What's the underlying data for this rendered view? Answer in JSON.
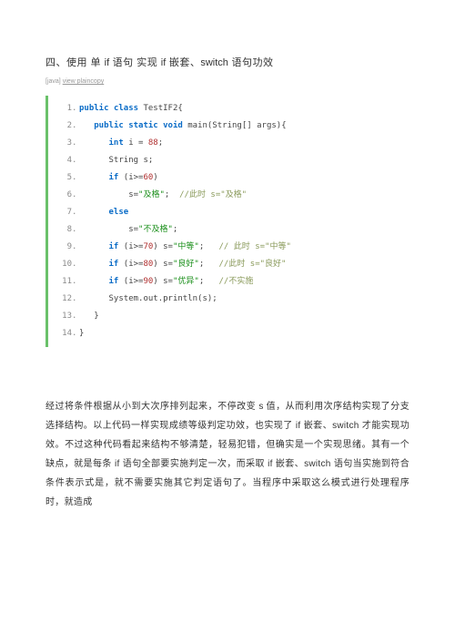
{
  "heading": {
    "prefix": "四、使用 单 ",
    "if": "if",
    "mid1": " 语句  实现 ",
    "if2": "if",
    "mid2": " 嵌套、",
    "switch": "switch",
    "suffix": " 语句功效"
  },
  "meta": {
    "lang": "[java]",
    "links": "view plaincopy"
  },
  "code": [
    {
      "n": "1",
      "parts": [
        {
          "t": "kw",
          "v": "public"
        },
        {
          "t": "p",
          "v": " "
        },
        {
          "t": "kw",
          "v": "class"
        },
        {
          "t": "p",
          "v": " TestIF2{"
        }
      ]
    },
    {
      "n": "2",
      "indent": "   ",
      "parts": [
        {
          "t": "kw",
          "v": "public"
        },
        {
          "t": "p",
          "v": " "
        },
        {
          "t": "kw",
          "v": "static"
        },
        {
          "t": "p",
          "v": " "
        },
        {
          "t": "type",
          "v": "void"
        },
        {
          "t": "p",
          "v": " main(String[] args){"
        }
      ]
    },
    {
      "n": "3",
      "indent": "      ",
      "parts": [
        {
          "t": "type",
          "v": "int"
        },
        {
          "t": "p",
          "v": " i = "
        },
        {
          "t": "num",
          "v": "88"
        },
        {
          "t": "p",
          "v": ";"
        }
      ]
    },
    {
      "n": "4",
      "indent": "      ",
      "parts": [
        {
          "t": "p",
          "v": "String s;"
        }
      ]
    },
    {
      "n": "5",
      "indent": "      ",
      "parts": [
        {
          "t": "kw",
          "v": "if"
        },
        {
          "t": "p",
          "v": " (i>="
        },
        {
          "t": "num",
          "v": "60"
        },
        {
          "t": "p",
          "v": ")"
        }
      ]
    },
    {
      "n": "6",
      "indent": "          ",
      "parts": [
        {
          "t": "p",
          "v": "s="
        },
        {
          "t": "str",
          "v": "\"及格\""
        },
        {
          "t": "p",
          "v": ";  "
        },
        {
          "t": "cmt",
          "v": "//此时 s=\"及格\""
        }
      ]
    },
    {
      "n": "7",
      "indent": "      ",
      "parts": [
        {
          "t": "kw",
          "v": "else"
        }
      ]
    },
    {
      "n": "8",
      "indent": "          ",
      "parts": [
        {
          "t": "p",
          "v": "s="
        },
        {
          "t": "str",
          "v": "\"不及格\""
        },
        {
          "t": "p",
          "v": ";"
        }
      ]
    },
    {
      "n": "9",
      "indent": "      ",
      "parts": [
        {
          "t": "kw",
          "v": "if"
        },
        {
          "t": "p",
          "v": " (i>="
        },
        {
          "t": "num",
          "v": "70"
        },
        {
          "t": "p",
          "v": ") s="
        },
        {
          "t": "str",
          "v": "\"中等\""
        },
        {
          "t": "p",
          "v": ";   "
        },
        {
          "t": "cmt",
          "v": "// 此时 s=\"中等\""
        }
      ]
    },
    {
      "n": "10",
      "indent": "      ",
      "parts": [
        {
          "t": "kw",
          "v": "if"
        },
        {
          "t": "p",
          "v": " (i>="
        },
        {
          "t": "num",
          "v": "80"
        },
        {
          "t": "p",
          "v": ") s="
        },
        {
          "t": "str",
          "v": "\"良好\""
        },
        {
          "t": "p",
          "v": ";   "
        },
        {
          "t": "cmt",
          "v": "//此时 s=\"良好\""
        }
      ]
    },
    {
      "n": "11",
      "indent": "      ",
      "parts": [
        {
          "t": "kw",
          "v": "if"
        },
        {
          "t": "p",
          "v": " (i>="
        },
        {
          "t": "num",
          "v": "90"
        },
        {
          "t": "p",
          "v": ") s="
        },
        {
          "t": "str",
          "v": "\"优异\""
        },
        {
          "t": "p",
          "v": ";   "
        },
        {
          "t": "cmt",
          "v": "//不实施"
        }
      ]
    },
    {
      "n": "12",
      "indent": "      ",
      "parts": [
        {
          "t": "p",
          "v": "System.out.println(s);"
        }
      ]
    },
    {
      "n": "13",
      "indent": "   ",
      "parts": [
        {
          "t": "p",
          "v": "}"
        }
      ]
    },
    {
      "n": "14",
      "parts": [
        {
          "t": "p",
          "v": "}"
        }
      ]
    }
  ],
  "paragraph": {
    "p1a": "经过将条件根据从小到大次序排列起来，不停改变 ",
    "p1b": "s",
    "p1c": " 值，从而利用次序结构实现了分支选择结构。以上代码一样实现成绩等级判定功效，也实现了 if 嵌套、switch 才能实现功效。不过这种代码看起来结构不够清楚，轻易犯错，但确实是一个实现思绪。其有一个缺点，就是每条 if 语句全部要实施判定一次，而采取 if 嵌套、switch 语句当实施到符合条件表示式是，就不需要实施其它判定语句了。当程序中采取这么模式进行处理程序时，就造成"
  }
}
